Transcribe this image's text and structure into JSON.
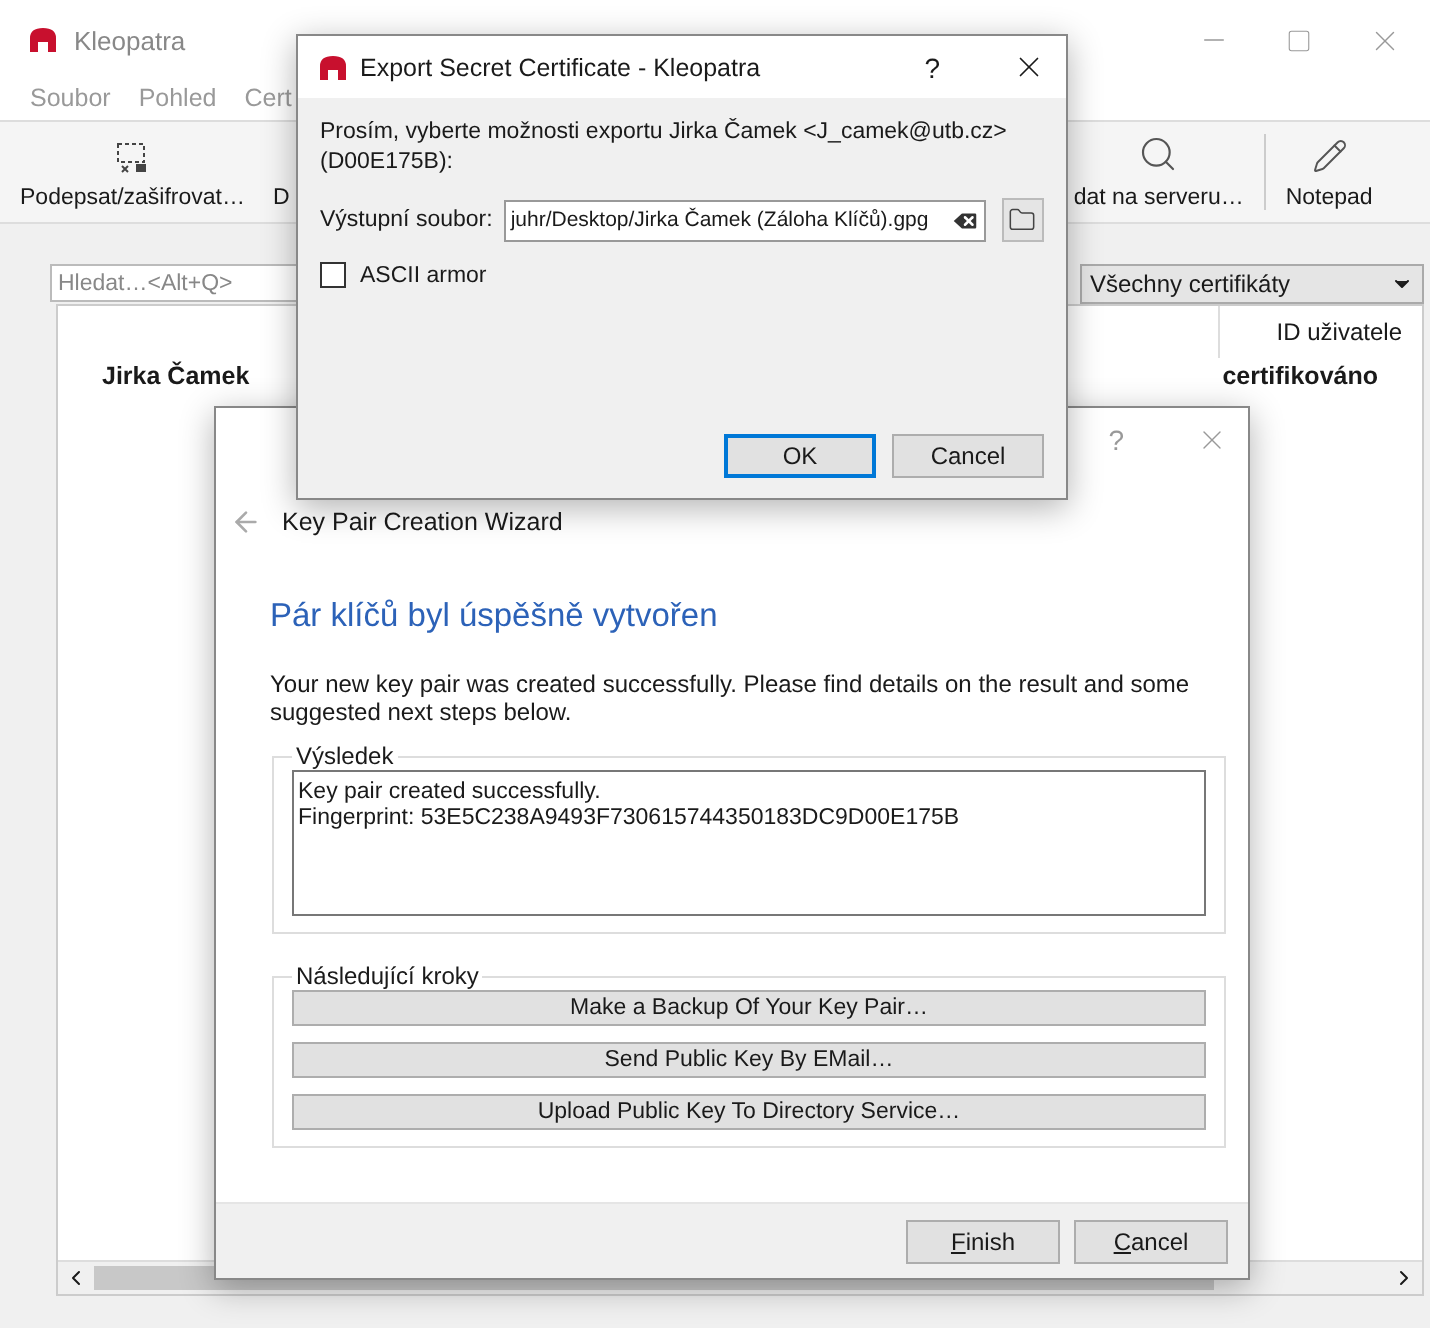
{
  "main_window": {
    "title": "Kleopatra",
    "menu": [
      "Soubor",
      "Pohled",
      "Cert"
    ],
    "toolbar": [
      {
        "label": "Podepsat/zašifrovat…",
        "kind": "sign",
        "separator": false
      },
      {
        "label": "D",
        "kind": "plain",
        "separator": false
      },
      {
        "label": "dat na serveru…",
        "kind": "search",
        "separator": false
      },
      {
        "label": "Notepad",
        "kind": "pencil",
        "separator": true
      }
    ],
    "search": {
      "placeholder": "Hledat…<Alt+Q>"
    },
    "filter": {
      "value": "Všechny certifikáty"
    },
    "table": {
      "columns": [
        "ID uživatele"
      ],
      "rows": [
        {
          "name": "Jirka Čamek",
          "status": "certifikováno"
        }
      ]
    }
  },
  "export_dialog": {
    "title": "Export Secret Certificate - Kleopatra",
    "help": "?",
    "message": "Prosím, vyberte možnosti exportu Jirka Čamek <J_camek@utb.cz> (D00E175B):",
    "output_label": "Výstupní soubor:",
    "output_value": "juhr/Desktop/Jirka Čamek (Záloha Klíčů).gpg",
    "ascii_armor": {
      "label": "ASCII armor",
      "checked": false
    },
    "buttons": [
      {
        "label": "OK",
        "default": true
      },
      {
        "label": "Cancel",
        "default": false
      }
    ]
  },
  "wizard": {
    "help": "?",
    "header": "Key Pair Creation Wizard",
    "heading": "Pár klíčů byl úspěšně vytvořen",
    "intro": "Your new key pair was created successfully. Please find details on the result and some suggested next steps below.",
    "result": {
      "title": "Výsledek",
      "lines": [
        "Key pair created successfully.",
        "Fingerprint: 53E5C238A9493F730615744350183DC9D00E175B"
      ]
    },
    "next_steps": {
      "title": "Následující kroky",
      "buttons": [
        "Make a Backup Of Your Key Pair…",
        "Send Public Key By EMail…",
        "Upload Public Key To Directory Service…"
      ]
    },
    "buttons": [
      "Finish",
      "Cancel"
    ]
  }
}
